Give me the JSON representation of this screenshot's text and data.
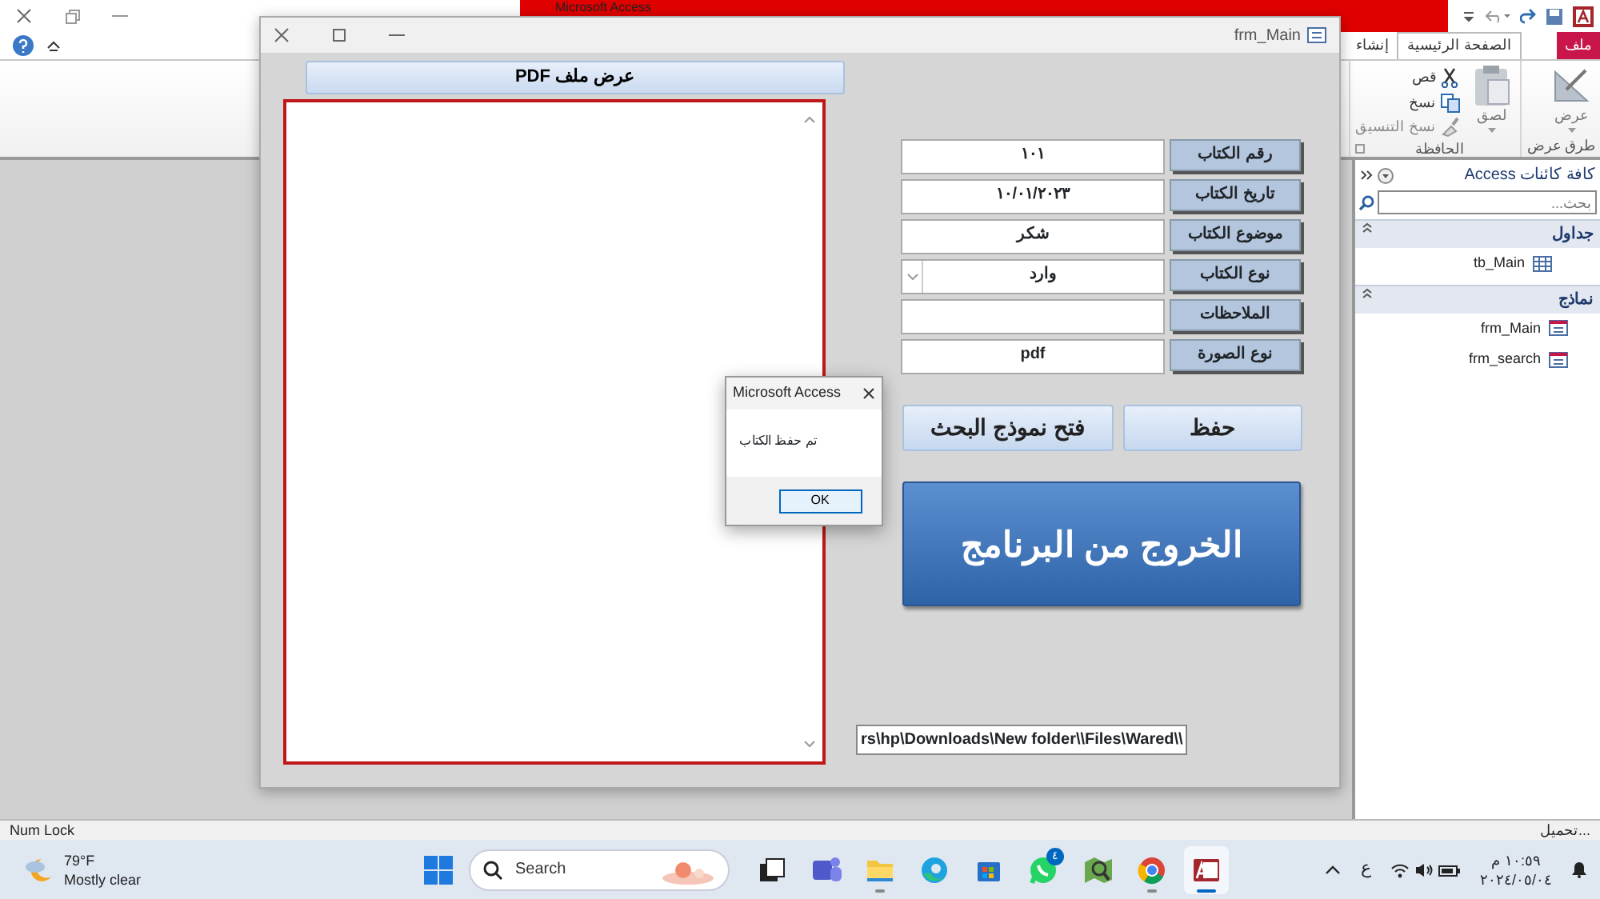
{
  "app": {
    "title": "Microsoft Access"
  },
  "ribbon": {
    "tabs": [
      {
        "label": "ملف",
        "kind": "file",
        "selected": false
      },
      {
        "label": "الصفحة الرئيسية",
        "kind": "tab",
        "selected": true
      },
      {
        "label": "إنشاء",
        "kind": "tab",
        "selected": false
      }
    ],
    "groups": [
      {
        "name": "طرق عرض",
        "buttons": [
          {
            "label": "عرض",
            "kind": "view"
          }
        ]
      },
      {
        "name": "الحافظة",
        "buttons": [
          {
            "label": "لصق",
            "kind": "paste"
          },
          {
            "label": "قص",
            "kind": "cut"
          },
          {
            "label": "نسخ",
            "kind": "copy"
          },
          {
            "label": "نسخ التنسيق",
            "kind": "format"
          }
        ]
      }
    ]
  },
  "nav_pane": {
    "title": "كافة كائنات Access",
    "search": {
      "placeholder": "بحث..."
    },
    "groups": [
      {
        "label": "جداول",
        "items": [
          {
            "label": "tb_Main",
            "kind": "table"
          }
        ]
      },
      {
        "label": "نماذج",
        "items": [
          {
            "label": "frm_Main",
            "kind": "form"
          },
          {
            "label": "frm_search",
            "kind": "form"
          }
        ]
      }
    ]
  },
  "form": {
    "title": "frm_Main",
    "pdf_button": "عرض ملف PDF",
    "fields": [
      {
        "label": "رقم الكتاب",
        "value": "١٠١",
        "kind": "text"
      },
      {
        "label": "تاريخ الكتاب",
        "value": "١٠/٠١/٢٠٢٣",
        "kind": "text"
      },
      {
        "label": "موضوع الكتاب",
        "value": "شكر",
        "kind": "text"
      },
      {
        "label": "نوع الكتاب",
        "value": "وارد",
        "kind": "combo"
      },
      {
        "label": "الملاحظات",
        "kind": "text"
      },
      {
        "label": "نوع الصورة",
        "value": "pdf",
        "kind": "text"
      }
    ],
    "buttons": [
      "حفظ",
      "فتح نموذج البحث"
    ],
    "exit_button": "الخروج من البرنامج",
    "path": "rs\\hp\\Downloads\\New folder\\\\Files\\Wared\\\\"
  },
  "dialog": {
    "title": "Microsoft Access",
    "message": "تم حفظ الكتاب",
    "button": "OK"
  },
  "status_bar": {
    "left": "Num Lock",
    "right": "تحميل..."
  },
  "taskbar": {
    "weather": {
      "temperature": "79°F",
      "condition": "Mostly clear"
    },
    "search": "Search",
    "apps": [
      {
        "kind": "taskview",
        "open": false,
        "selected": false
      },
      {
        "kind": "teams",
        "open": false,
        "selected": false
      },
      {
        "kind": "explorer",
        "open": true,
        "selected": false
      },
      {
        "kind": "edge",
        "open": false,
        "selected": false
      },
      {
        "kind": "store",
        "open": false,
        "selected": false
      },
      {
        "kind": "whatsapp",
        "open": false,
        "selected": false,
        "badge": "٤"
      },
      {
        "kind": "maps",
        "open": false,
        "selected": false
      },
      {
        "kind": "chrome",
        "open": true,
        "selected": false
      },
      {
        "kind": "access",
        "open": true,
        "selected": true
      }
    ],
    "language": "ع",
    "time": "١٠:٥٩ م",
    "date": "٢٠٢٤/٠٥/٠٤"
  }
}
